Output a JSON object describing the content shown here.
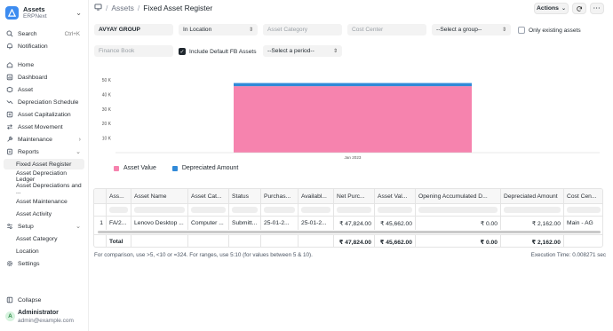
{
  "app": {
    "title": "Assets",
    "subtitle": "ERPNext"
  },
  "sidebar": {
    "search_label": "Search",
    "search_shortcut": "Ctrl+K",
    "notification_label": "Notification",
    "items": [
      {
        "label": "Home"
      },
      {
        "label": "Dashboard"
      },
      {
        "label": "Asset"
      },
      {
        "label": "Depreciation Schedule"
      },
      {
        "label": "Asset Capitalization"
      },
      {
        "label": "Asset Movement"
      },
      {
        "label": "Maintenance"
      },
      {
        "label": "Reports"
      },
      {
        "label": "Fixed Asset Register"
      },
      {
        "label": "Asset Depreciation Ledger"
      },
      {
        "label": "Asset Depreciations and ..."
      },
      {
        "label": "Asset Maintenance"
      },
      {
        "label": "Asset Activity"
      },
      {
        "label": "Setup"
      },
      {
        "label": "Asset Category"
      },
      {
        "label": "Location"
      },
      {
        "label": "Settings"
      }
    ],
    "collapse_label": "Collapse"
  },
  "user": {
    "initial": "A",
    "name": "Administrator",
    "email": "admin@example.com"
  },
  "header": {
    "crumb_1": "Assets",
    "crumb_2": "Fixed Asset Register",
    "actions_label": "Actions"
  },
  "filters": {
    "company": "AVYAY GROUP",
    "status": "In Location",
    "asset_category_placeholder": "Asset Category",
    "cost_center_placeholder": "Cost Center",
    "group_by": "--Select a group--",
    "only_existing_label": "Only existing assets",
    "finance_book_placeholder": "Finance Book",
    "include_default_label": "Include Default FB Assets",
    "period": "--Select a period--"
  },
  "chart_data": {
    "type": "bar",
    "stacked": true,
    "categories": [
      "Jan 2023"
    ],
    "series": [
      {
        "name": "Asset Value",
        "values": [
          45662
        ],
        "color": "#f683ae"
      },
      {
        "name": "Depreciated Amount",
        "values": [
          2162
        ],
        "color": "#318ad8"
      }
    ],
    "y_ticks": [
      "10 K",
      "20 K",
      "30 K",
      "40 K",
      "50 K"
    ],
    "ylim": [
      0,
      50000
    ]
  },
  "table": {
    "columns": [
      "Ass...",
      "Asset Name",
      "Asset Cat...",
      "Status",
      "Purchas...",
      "Availabl...",
      "Net Purc...",
      "Asset Val...",
      "Opening Accumulated D...",
      "Depreciated Amount",
      "Cost Cen..."
    ],
    "row": {
      "index": "1",
      "cells": [
        "FA/2...",
        "Lenovo Desktop ...",
        "Computer ...",
        "Submitt...",
        "25-01-2...",
        "25-01-2...",
        "₹ 47,824.00",
        "₹ 45,662.00",
        "₹ 0.00",
        "₹ 2,162.00",
        "Main - AG"
      ]
    },
    "total": {
      "label": "Total",
      "net_purchase": "₹ 47,824.00",
      "asset_value": "₹ 45,662.00",
      "opening": "₹ 0.00",
      "depreciated": "₹ 2,162.00"
    }
  },
  "footer": {
    "hint": "For comparison, use >5, <10 or =324. For ranges, use 5:10 (for values between 5 & 10).",
    "execution": "Execution Time: 0.008271 sec"
  }
}
